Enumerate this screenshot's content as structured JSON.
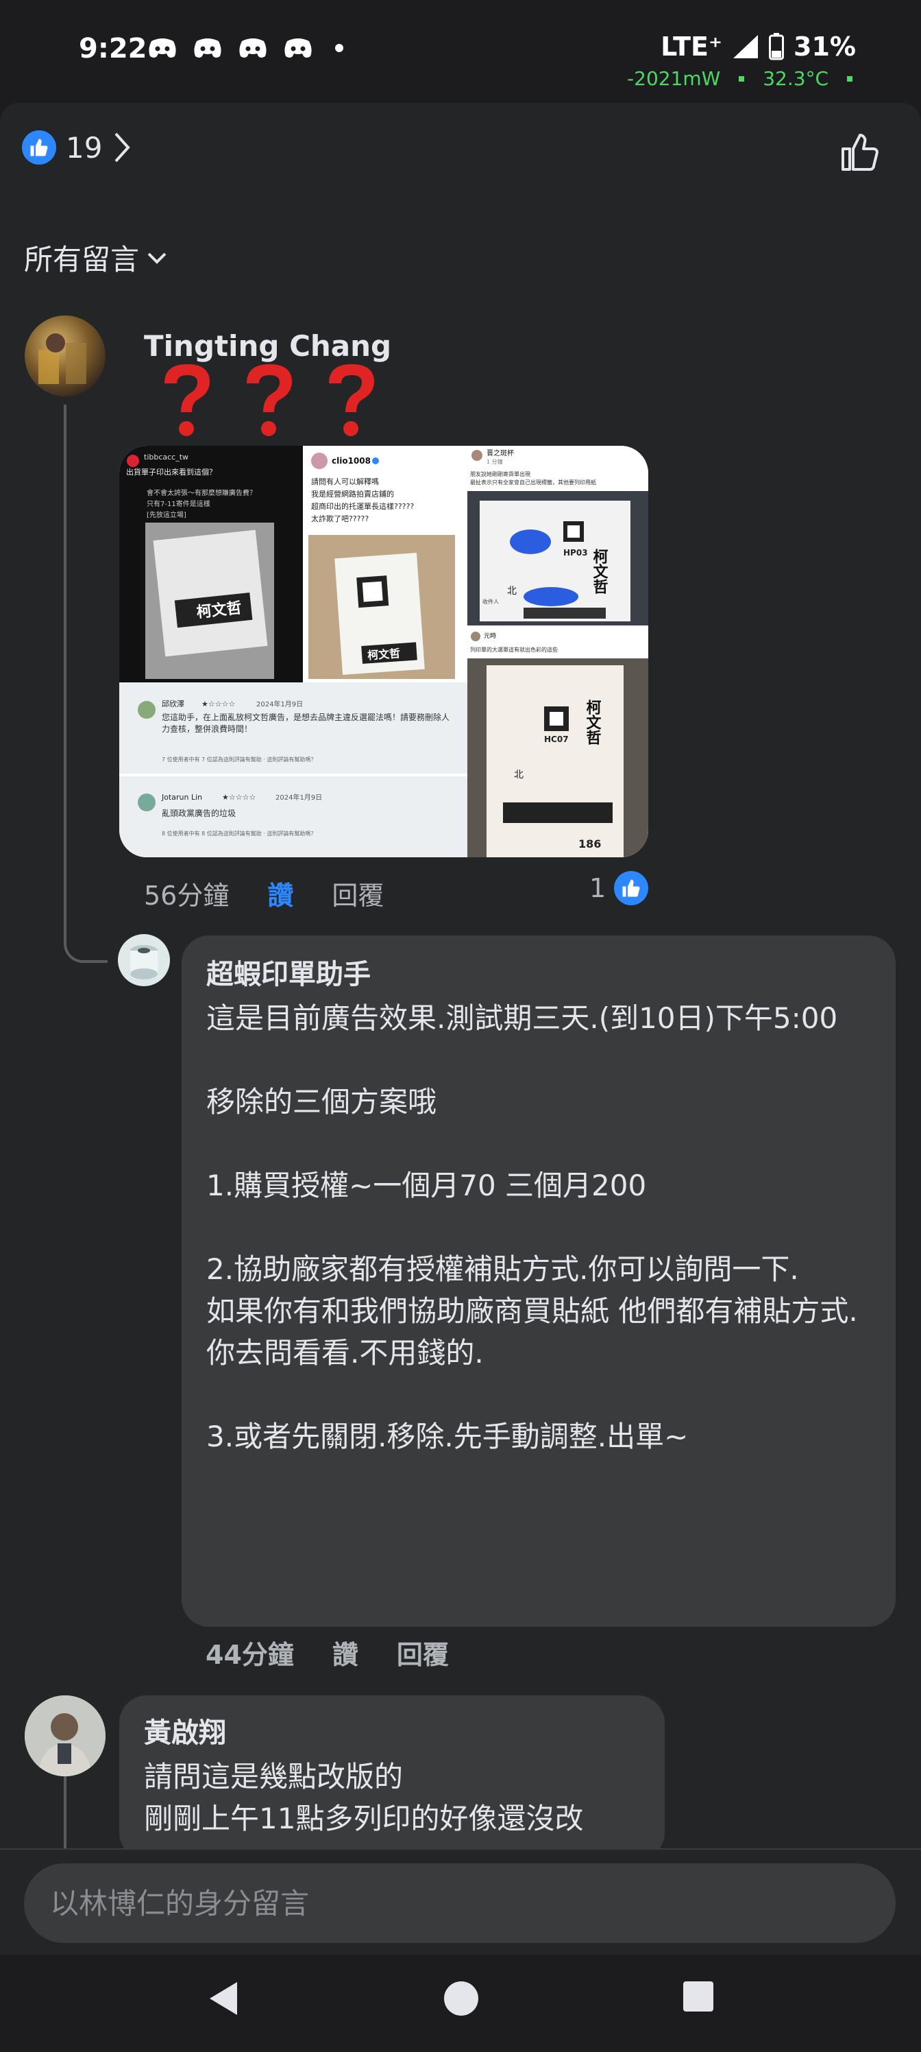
{
  "status": {
    "time": "9:22",
    "network": "LTE⁺",
    "battery": "31%",
    "power_readout": "-2021mW",
    "temp_readout": "32.3°C"
  },
  "reactions": {
    "count": "19"
  },
  "filter": {
    "label": "所有留言"
  },
  "comment1": {
    "author": "Tingting Chang",
    "time": "56分鐘",
    "like_label": "讚",
    "reply_label": "回覆",
    "like_count": "1",
    "collage": {
      "p1": {
        "user": "tibbcacc_tw",
        "line1": "出貨單子印出來看到這個？",
        "line2": "會不會太誇張～有那麼想賺廣告費？",
        "line3": "只有7-11寄件是這樣",
        "line4": "[先放這立場]",
        "stamp": "柯文哲"
      },
      "p2": {
        "user": "clio1008",
        "line1": "請問有人可以解釋嗎",
        "line2": "我是經營網路拍賣店鋪的",
        "line3": "超商印出的托運單長這樣?????",
        "line4": "太詐欺了吧?????",
        "stamp": "柯文哲"
      },
      "p3": {
        "user": "晋之斑杯",
        "sub": "1 分鐘",
        "line1": "朋友說她剛剛寄貨單出現",
        "line2": "最扯表示只有全家會自己出現標籤，其他要列印用紙",
        "stamp": "柯文哲",
        "code": "HP03",
        "label_city": "北",
        "footer": "收件人"
      },
      "p4": {
        "user": "元時",
        "line1": "列印單的大選單這有就出色彩的這些",
        "stamp": "柯文哲",
        "code": "HC07",
        "label_city": "北",
        "num": "186"
      },
      "r1": {
        "user": "邱欣澤",
        "stars": "★☆☆☆☆",
        "date": "2024年1月9日",
        "text": "您這助手，在上面亂放柯文哲廣告，是想去品牌主違反選罷法嗎！請要務刪除人力查核，整併浪費時間！",
        "foot": "7 位使用者中有 7 位認為這則評論有幫助 · 這則評論有幫助嗎？"
      },
      "r2": {
        "user": "Jotarun Lin",
        "stars": "★☆☆☆☆",
        "date": "2024年1月9日",
        "text": "亂頭政黨廣告的垃圾",
        "foot": "8 位使用者中有 8 位認為這則評論有幫助 · 這則評論有幫助嗎？"
      }
    }
  },
  "reply1": {
    "author": "超蝦印單助手",
    "text": "這是目前廣告效果.測試期三天.(到10日)下午5:00\n\n移除的三個方案哦\n\n1.購買授權~一個月70 三個月200\n\n2.協助廠家都有授權補貼方式.你可以詢問一下.\n如果你有和我們協助廠商買貼紙 他們都有補貼方式.你去問看看.不用錢的.\n\n3.或者先關閉.移除.先手動調整.出單~",
    "time": "44分鐘",
    "like_label": "讚",
    "reply_label": "回覆"
  },
  "comment2": {
    "author": "黃啟翔",
    "text": "請問這是幾點改版的\n剛剛上午11點多列印的好像還沒改"
  },
  "composer": {
    "placeholder": "以林博仁的身分留言"
  },
  "colors": {
    "accent": "#2d88ff",
    "bubble": "#3a3b3c",
    "sheet": "#242526",
    "status_green": "#4cd964"
  },
  "icons": [
    "discord-icon",
    "signal-icon",
    "battery-icon",
    "like-icon",
    "chevron-right-icon",
    "chevron-down-icon",
    "thumbs-up-outline-icon",
    "question-mark-icon",
    "back-icon",
    "home-icon",
    "recents-icon"
  ]
}
